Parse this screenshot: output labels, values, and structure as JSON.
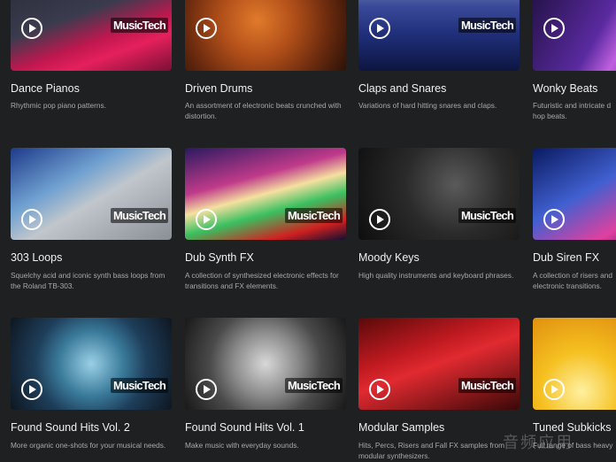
{
  "brand_label": "MusicTech",
  "cards": [
    {
      "title": "Dance Pianos",
      "desc": "Rhythmic pop piano patterns."
    },
    {
      "title": "Driven Drums",
      "desc": "An assortment of electronic beats crunched with distortion."
    },
    {
      "title": "Claps and Snares",
      "desc": "Variations of hard hitting snares and claps."
    },
    {
      "title": "Wonky Beats",
      "desc": "Futuristic and intricate d hop beats."
    },
    {
      "title": "303 Loops",
      "desc": "Squelchy acid and iconic synth bass loops from the Roland TB-303."
    },
    {
      "title": "Dub Synth FX",
      "desc": "A collection of synthesized electronic effects for transitions and FX elements."
    },
    {
      "title": "Moody Keys",
      "desc": "High quality instruments and keyboard phrases."
    },
    {
      "title": "Dub Siren FX",
      "desc": "A collection of risers and electronic transitions."
    },
    {
      "title": "Found Sound Hits Vol. 2",
      "desc": "More organic one-shots for your musical needs."
    },
    {
      "title": "Found Sound Hits Vol. 1",
      "desc": "Make music with everyday sounds."
    },
    {
      "title": "Modular Samples",
      "desc": "Hits, Percs, Risers and Fall FX samples from modular synthesizers."
    },
    {
      "title": "Tuned Subkicks",
      "desc": "Full range of bass heavy"
    }
  ],
  "watermark": "音频应用"
}
